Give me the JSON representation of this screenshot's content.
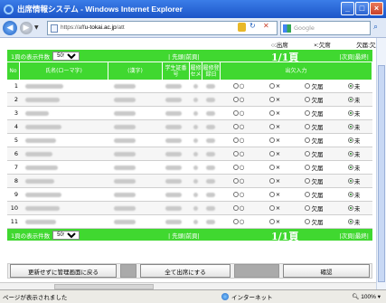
{
  "window": {
    "title": "出席情報システム - Windows Internet Explorer"
  },
  "address": {
    "url_prefix": "https://aff",
    "url_domain": "u-tokai.ac.jp",
    "url_suffix": "/att",
    "search_placeholder": "Google"
  },
  "legend": {
    "present": "○:出席",
    "absent": "×:欠席",
    "notice": "欠届:欠席 ↓"
  },
  "pager": {
    "per_page_label": "1頁の表示件数",
    "per_page_value": "50件",
    "first": "| 先頭|",
    "prev": "前頁|",
    "page": "1/1頁",
    "next": "|次頁|",
    "last": "最終|"
  },
  "headers": {
    "no": "No",
    "name": "氏名(ローマ字)",
    "kanji": "(漢字)",
    "student_no": "学生証番号",
    "semester": "履修セメ",
    "registered": "履修登録日",
    "attendance": "出欠入力"
  },
  "options": {
    "present": "○",
    "absent": "×",
    "notice": "欠届",
    "none": "未"
  },
  "rows": [
    {
      "no": "1"
    },
    {
      "no": "2"
    },
    {
      "no": "3"
    },
    {
      "no": "4"
    },
    {
      "no": "5"
    },
    {
      "no": "6"
    },
    {
      "no": "7"
    },
    {
      "no": "8"
    },
    {
      "no": "9"
    },
    {
      "no": "10"
    },
    {
      "no": "11"
    }
  ],
  "buttons": {
    "back": "更新せずに管理画面に戻る",
    "all_present": "全て出席にする",
    "confirm": "確認"
  },
  "status": {
    "message": "ページが表示されました",
    "zone": "インターネット",
    "zoom": "100%"
  }
}
